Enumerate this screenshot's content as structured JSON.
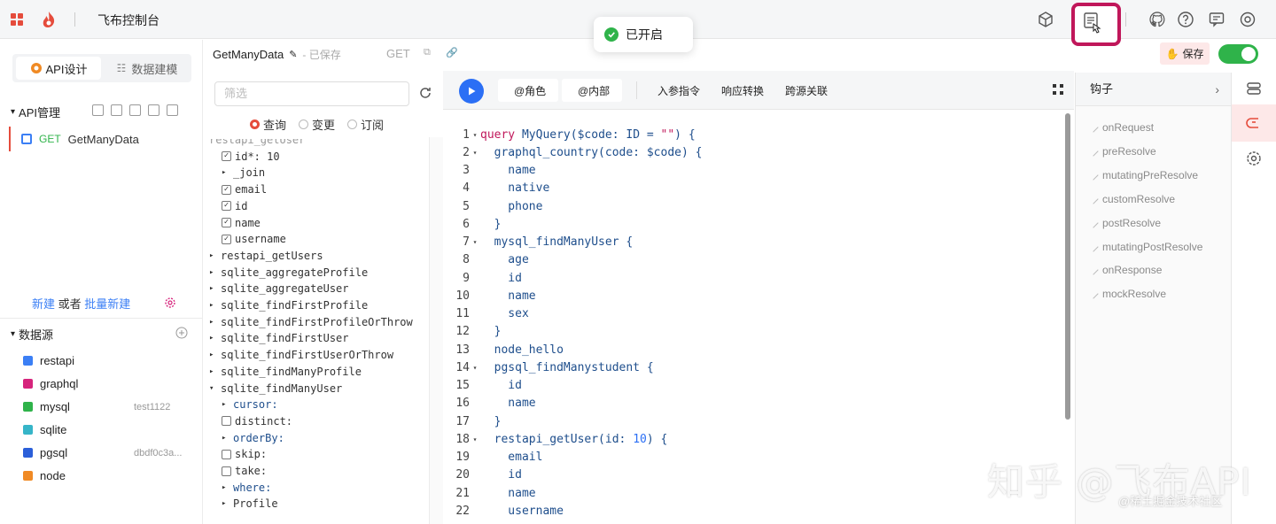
{
  "header": {
    "title": "飞布控制台",
    "toast": "已开启"
  },
  "left": {
    "tab_api": "API设计",
    "tab_data": "数据建模",
    "api_section": "API管理",
    "api_item_method": "GET",
    "api_item_name": "GetManyData",
    "new_link": "新建",
    "or_text": "或者",
    "batch_new_link": "批量新建",
    "datasource_section": "数据源",
    "datasources": [
      {
        "name": "restapi",
        "color": "#3b7ff5",
        "meta": ""
      },
      {
        "name": "graphql",
        "color": "#d6247c",
        "meta": ""
      },
      {
        "name": "mysql",
        "color": "#2fb34a",
        "meta": "test1122"
      },
      {
        "name": "sqlite",
        "color": "#36b5c8",
        "meta": ""
      },
      {
        "name": "pgsql",
        "color": "#2b5fd9",
        "meta": "dbdf0c3a..."
      },
      {
        "name": "node",
        "color": "#f08a24",
        "meta": ""
      }
    ]
  },
  "middle": {
    "doc_title": "GetManyData",
    "doc_status": "- 已保存",
    "method": "GET",
    "filter_placeholder": "筛选",
    "radio_query": "查询",
    "radio_mutation": "变更",
    "radio_subscription": "订阅",
    "tree": [
      {
        "label": "restapi_getUser",
        "indent": 0,
        "kind": "cut"
      },
      {
        "label": "id*: 10",
        "indent": 1,
        "kind": "checked"
      },
      {
        "label": "_join",
        "indent": 1,
        "kind": "arrow"
      },
      {
        "label": "email",
        "indent": 1,
        "kind": "checked"
      },
      {
        "label": "id",
        "indent": 1,
        "kind": "checked"
      },
      {
        "label": "name",
        "indent": 1,
        "kind": "checked"
      },
      {
        "label": "username",
        "indent": 1,
        "kind": "checked"
      },
      {
        "label": "restapi_getUsers",
        "indent": 0,
        "kind": "arrow"
      },
      {
        "label": "sqlite_aggregateProfile",
        "indent": 0,
        "kind": "arrow"
      },
      {
        "label": "sqlite_aggregateUser",
        "indent": 0,
        "kind": "arrow"
      },
      {
        "label": "sqlite_findFirstProfile",
        "indent": 0,
        "kind": "arrow"
      },
      {
        "label": "sqlite_findFirstProfileOrThrow",
        "indent": 0,
        "kind": "arrow"
      },
      {
        "label": "sqlite_findFirstUser",
        "indent": 0,
        "kind": "arrow"
      },
      {
        "label": "sqlite_findFirstUserOrThrow",
        "indent": 0,
        "kind": "arrow"
      },
      {
        "label": "sqlite_findManyProfile",
        "indent": 0,
        "kind": "arrow"
      },
      {
        "label": "sqlite_findManyUser",
        "indent": 0,
        "kind": "open"
      },
      {
        "label": "cursor:",
        "indent": 1,
        "kind": "arrow-blue"
      },
      {
        "label": "distinct:",
        "indent": 1,
        "kind": "unchecked"
      },
      {
        "label": "orderBy:",
        "indent": 1,
        "kind": "arrow-blue"
      },
      {
        "label": "skip:",
        "indent": 1,
        "kind": "unchecked"
      },
      {
        "label": "take:",
        "indent": 1,
        "kind": "unchecked"
      },
      {
        "label": "where:",
        "indent": 1,
        "kind": "arrow-blue"
      },
      {
        "label": "Profile",
        "indent": 1,
        "kind": "arrow"
      }
    ]
  },
  "toolbar": {
    "role": "@角色",
    "internal": "@内部",
    "input_directive": "入参指令",
    "response_transform": "响应转换",
    "cross_source": "跨源关联"
  },
  "code": [
    {
      "n": "1",
      "fold": true,
      "parts": [
        [
          "kw",
          "query "
        ],
        [
          "fn",
          "MyQuery"
        ],
        [
          "txt",
          "($code: ID = "
        ],
        [
          "str",
          "\"\""
        ],
        [
          "txt",
          ") {"
        ]
      ]
    },
    {
      "n": "2",
      "fold": true,
      "parts": [
        [
          "txt",
          "  graphql_country(code: $code) {"
        ]
      ]
    },
    {
      "n": "3",
      "fold": false,
      "parts": [
        [
          "txt",
          "    name"
        ]
      ]
    },
    {
      "n": "4",
      "fold": false,
      "parts": [
        [
          "txt",
          "    native"
        ]
      ]
    },
    {
      "n": "5",
      "fold": false,
      "parts": [
        [
          "txt",
          "    phone"
        ]
      ]
    },
    {
      "n": "6",
      "fold": false,
      "parts": [
        [
          "txt",
          "  }"
        ]
      ]
    },
    {
      "n": "7",
      "fold": true,
      "parts": [
        [
          "txt",
          "  mysql_findManyUser {"
        ]
      ]
    },
    {
      "n": "8",
      "fold": false,
      "parts": [
        [
          "txt",
          "    age"
        ]
      ]
    },
    {
      "n": "9",
      "fold": false,
      "parts": [
        [
          "txt",
          "    id"
        ]
      ]
    },
    {
      "n": "10",
      "fold": false,
      "parts": [
        [
          "txt",
          "    name"
        ]
      ]
    },
    {
      "n": "11",
      "fold": false,
      "parts": [
        [
          "txt",
          "    sex"
        ]
      ]
    },
    {
      "n": "12",
      "fold": false,
      "parts": [
        [
          "txt",
          "  }"
        ]
      ]
    },
    {
      "n": "13",
      "fold": false,
      "parts": [
        [
          "txt",
          "  node_hello"
        ]
      ]
    },
    {
      "n": "14",
      "fold": true,
      "parts": [
        [
          "txt",
          "  pgsql_findManystudent {"
        ]
      ]
    },
    {
      "n": "15",
      "fold": false,
      "parts": [
        [
          "txt",
          "    id"
        ]
      ]
    },
    {
      "n": "16",
      "fold": false,
      "parts": [
        [
          "txt",
          "    name"
        ]
      ]
    },
    {
      "n": "17",
      "fold": false,
      "parts": [
        [
          "txt",
          "  }"
        ]
      ]
    },
    {
      "n": "18",
      "fold": true,
      "parts": [
        [
          "txt",
          "  restapi_getUser(id: "
        ],
        [
          "num",
          "10"
        ],
        [
          "txt",
          ") {"
        ]
      ]
    },
    {
      "n": "19",
      "fold": false,
      "parts": [
        [
          "txt",
          "    email"
        ]
      ]
    },
    {
      "n": "20",
      "fold": false,
      "parts": [
        [
          "txt",
          "    id"
        ]
      ]
    },
    {
      "n": "21",
      "fold": false,
      "parts": [
        [
          "txt",
          "    name"
        ]
      ]
    },
    {
      "n": "22",
      "fold": false,
      "parts": [
        [
          "txt",
          "    username"
        ]
      ]
    }
  ],
  "right": {
    "save_label": "保存",
    "hooks_title": "钩子",
    "hooks": [
      "onRequest",
      "preResolve",
      "mutatingPreResolve",
      "customResolve",
      "postResolve",
      "mutatingPostResolve",
      "onResponse",
      "mockResolve"
    ]
  },
  "watermark": {
    "zhihu": "知乎 @飞布API",
    "juejin": "@稀土掘金技术社区"
  }
}
